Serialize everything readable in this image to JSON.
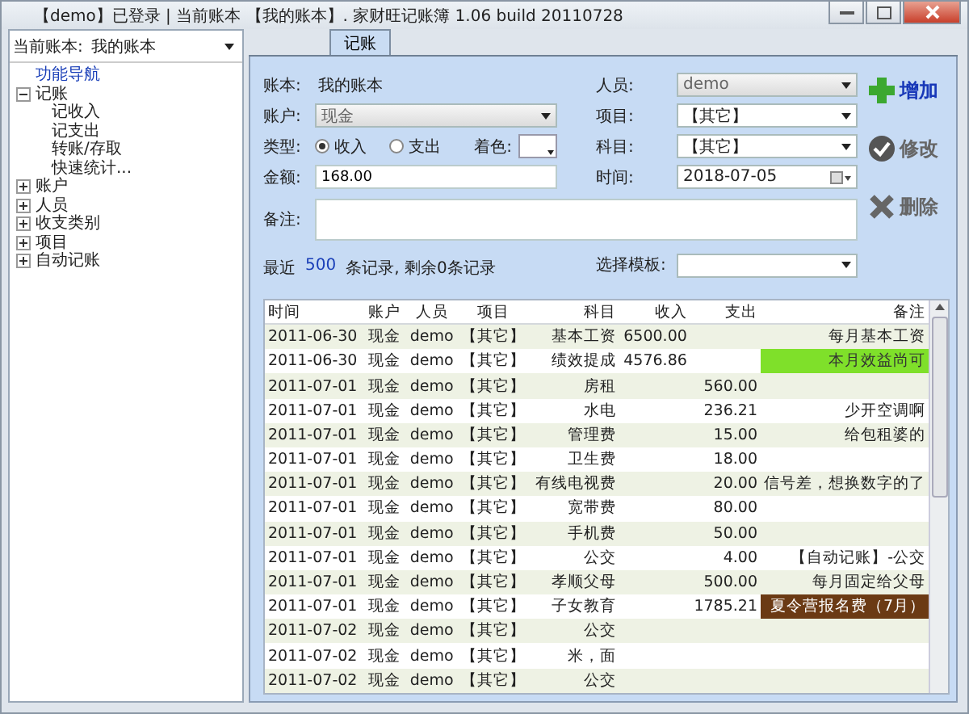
{
  "window": {
    "title": "【demo】已登录 | 当前账本 【我的账本】. 家财旺记账簿 1.06 build 20110728"
  },
  "sidebar": {
    "book_label": "当前账本:",
    "book_value": "我的账本",
    "tree": [
      {
        "label": "功能导航",
        "selected": true
      },
      {
        "label": "记账",
        "selected": false,
        "expanded": true,
        "children": [
          {
            "label": "记收入",
            "selected": false
          },
          {
            "label": "记支出",
            "selected": false
          },
          {
            "label": "转账/存取",
            "selected": false
          },
          {
            "label": "快速统计...",
            "selected": false
          }
        ]
      },
      {
        "label": "账户",
        "selected": false,
        "expanded": false
      },
      {
        "label": "人员",
        "selected": false,
        "expanded": false
      },
      {
        "label": "收支类别",
        "selected": false,
        "expanded": false
      },
      {
        "label": "项目",
        "selected": false,
        "expanded": false
      },
      {
        "label": "自动记账",
        "selected": false,
        "expanded": false
      }
    ]
  },
  "tabs": [
    {
      "label": "记账",
      "selected": true
    }
  ],
  "form": {
    "book": {
      "label": "账本:",
      "value": "我的账本"
    },
    "account": {
      "label": "账户:",
      "value": "现金"
    },
    "type": {
      "label": "类型:",
      "options": [
        {
          "label": "收入",
          "selected": true
        },
        {
          "label": "支出",
          "selected": false
        }
      ]
    },
    "color": {
      "label": "着色:"
    },
    "amount": {
      "label": "金额:",
      "value": "168.00"
    },
    "note": {
      "label": "备注:"
    },
    "person": {
      "label": "人员:",
      "value": "demo"
    },
    "project": {
      "label": "项目:",
      "value": "【其它】"
    },
    "subject": {
      "label": "科目:",
      "value": "【其它】"
    },
    "time": {
      "label": "时间:",
      "value": "2018-07-05"
    },
    "recent": {
      "prefix": "最近",
      "count": "500",
      "suffix": "条记录, 剩余0条记录"
    },
    "template": {
      "label": "选择模板:"
    }
  },
  "actions": [
    {
      "label": "增加",
      "kind": "add"
    },
    {
      "label": "修改",
      "kind": "edit"
    },
    {
      "label": "删除",
      "kind": "delete"
    }
  ],
  "table": {
    "columns": [
      "时间",
      "账户",
      "人员",
      "项目",
      "科目",
      "收入",
      "支出",
      "备注"
    ],
    "rows": [
      {
        "cells": [
          "2011-06-30",
          "现金",
          "demo",
          "【其它】",
          "基本工资",
          "6500.00",
          "",
          "每月基本工资"
        ]
      },
      {
        "cells": [
          "2011-06-30",
          "现金",
          "demo",
          "【其它】",
          "绩效提成",
          "4576.86",
          "",
          "本月效益尚可"
        ],
        "color": "#7fe02a"
      },
      {
        "cells": [
          "2011-07-01",
          "现金",
          "demo",
          "【其它】",
          "房租",
          "",
          "560.00",
          ""
        ]
      },
      {
        "cells": [
          "2011-07-01",
          "现金",
          "demo",
          "【其它】",
          "水电",
          "",
          "236.21",
          "少开空调啊"
        ]
      },
      {
        "cells": [
          "2011-07-01",
          "现金",
          "demo",
          "【其它】",
          "管理费",
          "",
          "15.00",
          "给包租婆的"
        ]
      },
      {
        "cells": [
          "2011-07-01",
          "现金",
          "demo",
          "【其它】",
          "卫生费",
          "",
          "18.00",
          ""
        ]
      },
      {
        "cells": [
          "2011-07-01",
          "现金",
          "demo",
          "【其它】",
          "有线电视费",
          "",
          "20.00",
          "信号差，想换数字的了"
        ]
      },
      {
        "cells": [
          "2011-07-01",
          "现金",
          "demo",
          "【其它】",
          "宽带费",
          "",
          "80.00",
          ""
        ]
      },
      {
        "cells": [
          "2011-07-01",
          "现金",
          "demo",
          "【其它】",
          "手机费",
          "",
          "50.00",
          ""
        ]
      },
      {
        "cells": [
          "2011-07-01",
          "现金",
          "demo",
          "【其它】",
          "公交",
          "",
          "4.00",
          "【自动记账】-公交"
        ]
      },
      {
        "cells": [
          "2011-07-01",
          "现金",
          "demo",
          "【其它】",
          "孝顺父母",
          "",
          "500.00",
          "每月固定给父母"
        ]
      },
      {
        "cells": [
          "2011-07-01",
          "现金",
          "demo",
          "【其它】",
          "子女教育",
          "",
          "1785.21",
          "夏令营报名费（7月）"
        ],
        "color": "#6b3a14"
      },
      {
        "cells": [
          "2011-07-02",
          "现金",
          "demo",
          "【其它】",
          "公交",
          "",
          "",
          ""
        ]
      },
      {
        "cells": [
          "2011-07-02",
          "现金",
          "demo",
          "【其它】",
          "米，面",
          "",
          "",
          ""
        ]
      },
      {
        "cells": [
          "2011-07-02",
          "现金",
          "demo",
          "【其它】",
          "公交",
          "",
          "",
          ""
        ]
      }
    ]
  }
}
